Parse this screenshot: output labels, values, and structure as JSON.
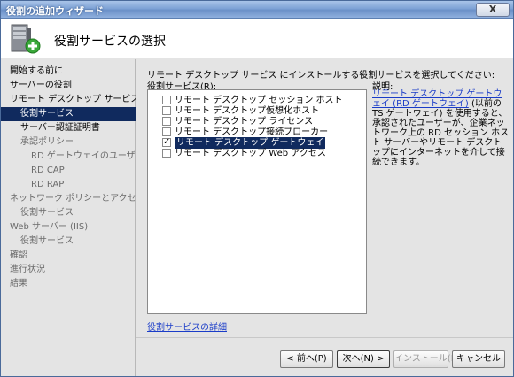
{
  "window": {
    "title": "役割の追加ウィザード",
    "close": "X"
  },
  "header": {
    "title": "役割サービスの選択"
  },
  "nav": {
    "items": [
      {
        "label": "開始する前に"
      },
      {
        "label": "サーバーの役割"
      },
      {
        "label": "リモート デスクトップ サービス"
      },
      {
        "label": "役割サービス"
      },
      {
        "label": "サーバー認証証明書"
      },
      {
        "label": "承認ポリシー"
      },
      {
        "label": "RD ゲートウェイのユーザー グ..."
      },
      {
        "label": "RD CAP"
      },
      {
        "label": "RD RAP"
      },
      {
        "label": "ネットワーク ポリシーとアクセス サービ..."
      },
      {
        "label": "役割サービス"
      },
      {
        "label": "Web サーバー (IIS)"
      },
      {
        "label": "役割サービス"
      },
      {
        "label": "確認"
      },
      {
        "label": "進行状況"
      },
      {
        "label": "結果"
      }
    ]
  },
  "content": {
    "instruction": "リモート デスクトップ サービス にインストールする役割サービスを選択してください:",
    "roles_label": "役割サービス(R):",
    "roles": [
      {
        "label": "リモート デスクトップ セッション ホスト",
        "checked": false
      },
      {
        "label": "リモート デスクトップ仮想化ホスト",
        "checked": false
      },
      {
        "label": "リモート デスクトップ ライセンス",
        "checked": false
      },
      {
        "label": "リモート デスクトップ接続ブローカー",
        "checked": false
      },
      {
        "label": "リモート デスクトップ ゲートウェイ",
        "checked": true
      },
      {
        "label": "リモート デスクトップ Web アクセス",
        "checked": false
      }
    ],
    "check_mark": "✓",
    "description_label": "説明:",
    "description_link": "リモート デスクトップ ゲートウェイ (RD ゲートウェイ)",
    "description_text": " (以前の TS ゲートウェイ) を使用すると、承認されたユーザーが、企業ネットワーク上の RD セッション ホスト サーバーやリモート デスクトップにインターネットを介して接続できます。",
    "details_link": "役割サービスの詳細"
  },
  "footer": {
    "back": "< 前へ(P)",
    "next": "次へ(N) >",
    "install": "インストール(I)",
    "cancel": "キャンセル"
  }
}
